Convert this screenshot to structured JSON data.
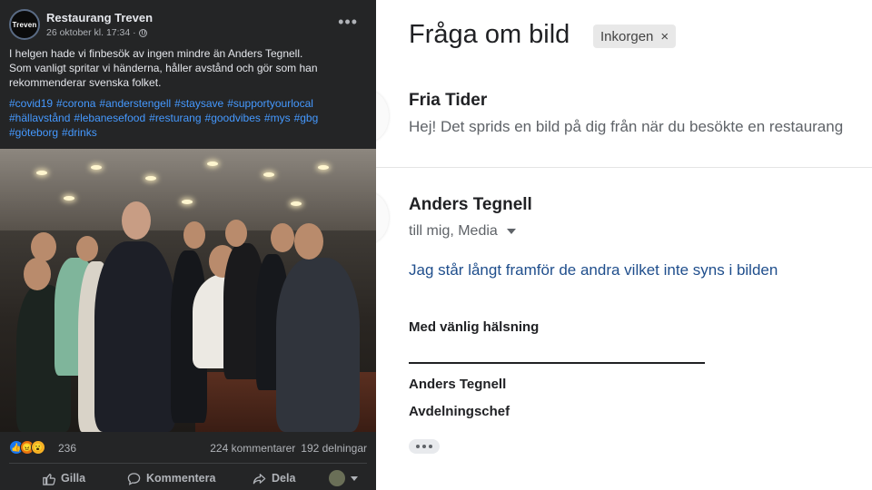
{
  "facebook_post": {
    "page_name": "Restaurang Treven",
    "avatar_text": "Treven",
    "timestamp": "26 oktober kl. 17:34 ·",
    "body_lines": [
      "I helgen hade vi finbesök av ingen mindre än Anders Tegnell.",
      "Som vanligt spritar vi händerna, håller avstånd och gör som han",
      "rekommenderar svenska folket."
    ],
    "hashtags": [
      "#covid19",
      "#corona",
      "#anderstengell",
      "#staysave",
      "#supportyourlocal",
      "#hällavstånd",
      "#lebanesefood",
      "#resturang",
      "#goodvibes",
      "#mys",
      "#gbg",
      "#göteborg",
      "#drinks"
    ],
    "reaction_count": "236",
    "comments": "224 kommentarer",
    "shares": "192 delningar",
    "actions": {
      "like": "Gilla",
      "comment": "Kommentera",
      "share": "Dela"
    }
  },
  "email": {
    "subject": "Fråga om bild",
    "label": "Inkorgen",
    "message1": {
      "sender": "Fria Tider",
      "snippet": "Hej! Det sprids en bild på dig från när du besökte en restaurang"
    },
    "message2": {
      "sender": "Anders Tegnell",
      "recipients": "till mig, Media",
      "body": "Jag står långt framför de andra vilket inte syns i bilden",
      "closing": "Med vänlig hälsning",
      "signature_name": "Anders Tegnell",
      "signature_title": "Avdelningschef"
    }
  },
  "colors": {
    "fb_background": "#242526",
    "fb_hashtag": "#4599ff",
    "email_link": "#1f4e8c"
  },
  "icons": [
    "globe-icon",
    "more-options-icon",
    "like-icon",
    "comment-icon",
    "share-icon",
    "caret-down-icon",
    "close-icon"
  ]
}
